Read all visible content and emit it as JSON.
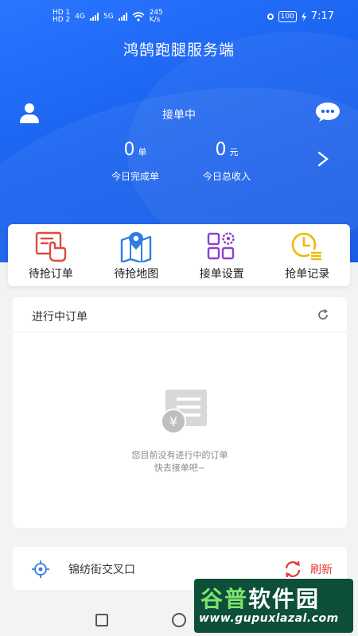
{
  "status_bar": {
    "hd_top": "HD 1",
    "hd_bottom": "HD 2",
    "net1": "4G",
    "net2": "5G",
    "speed_value": "245",
    "speed_unit": "K/s",
    "battery": "100",
    "time": "7:17"
  },
  "header": {
    "app_title": "鸿鹄跑腿服务端",
    "status_label": "接单中"
  },
  "stats": [
    {
      "value": "0",
      "unit": "单",
      "caption": "今日完成单"
    },
    {
      "value": "0",
      "unit": "元",
      "caption": "今日总收入"
    }
  ],
  "menu": [
    {
      "label": "待抢订单",
      "icon": "hand-pointer-icon"
    },
    {
      "label": "待抢地图",
      "icon": "map-pin-icon"
    },
    {
      "label": "接单设置",
      "icon": "grid-gear-icon"
    },
    {
      "label": "抢单记录",
      "icon": "clock-list-icon"
    }
  ],
  "orders": {
    "title": "进行中订单",
    "empty_line1": "您目前没有进行中的订单",
    "empty_line2": "快去接单吧~"
  },
  "location": {
    "address": "锦纺街交叉口",
    "refresh_label": "刷新"
  },
  "watermark": {
    "text_green": "谷普",
    "text_white": "软件园",
    "url": "www.gupuxlazal.com"
  },
  "colors": {
    "primary": "#1a63f0",
    "menu_red": "#e04a3f",
    "menu_blue": "#2f7fe0",
    "menu_purple": "#8e3fd1",
    "menu_yellow": "#f2b705",
    "refresh_red": "#e53935"
  }
}
